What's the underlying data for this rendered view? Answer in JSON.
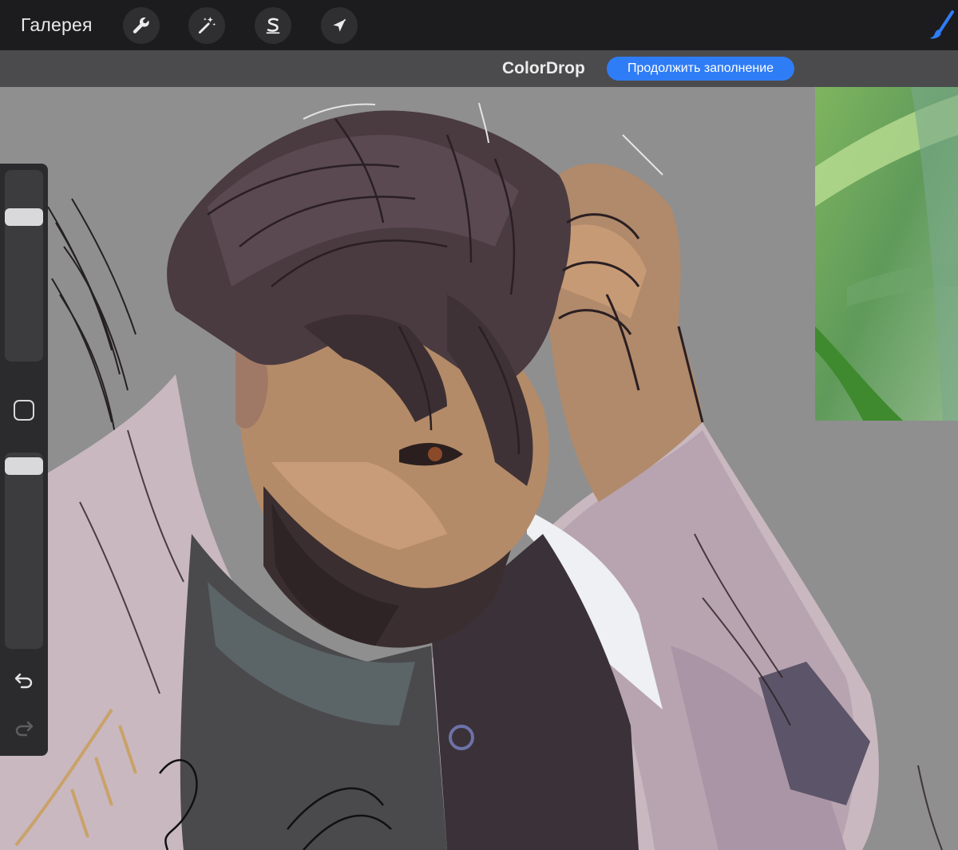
{
  "toolbar": {
    "gallery_label": "Галерея",
    "tools": [
      {
        "name": "actions",
        "icon": "wrench-icon"
      },
      {
        "name": "adjustments",
        "icon": "magic-wand-icon"
      },
      {
        "name": "selection",
        "icon": "selection-s-icon"
      },
      {
        "name": "transform",
        "icon": "arrow-cursor-icon"
      }
    ],
    "brush_icon": "brush-icon",
    "brush_color": "#2f7df6"
  },
  "banner": {
    "title": "ColorDrop",
    "continue_button_label": "Продолжить заполнение",
    "accent_color": "#2f7df6"
  },
  "sidebar": {
    "brush_size_level": 0.78,
    "opacity_level": 1.0,
    "modify_icon": "square-outline-icon",
    "undo_icon": "undo-icon",
    "redo_icon": "redo-icon"
  },
  "canvas": {
    "background_color": "#8f8f8f",
    "artwork": "illustration-man-hand-in-hair",
    "reference_panel": "reference-image-green-leaves"
  }
}
